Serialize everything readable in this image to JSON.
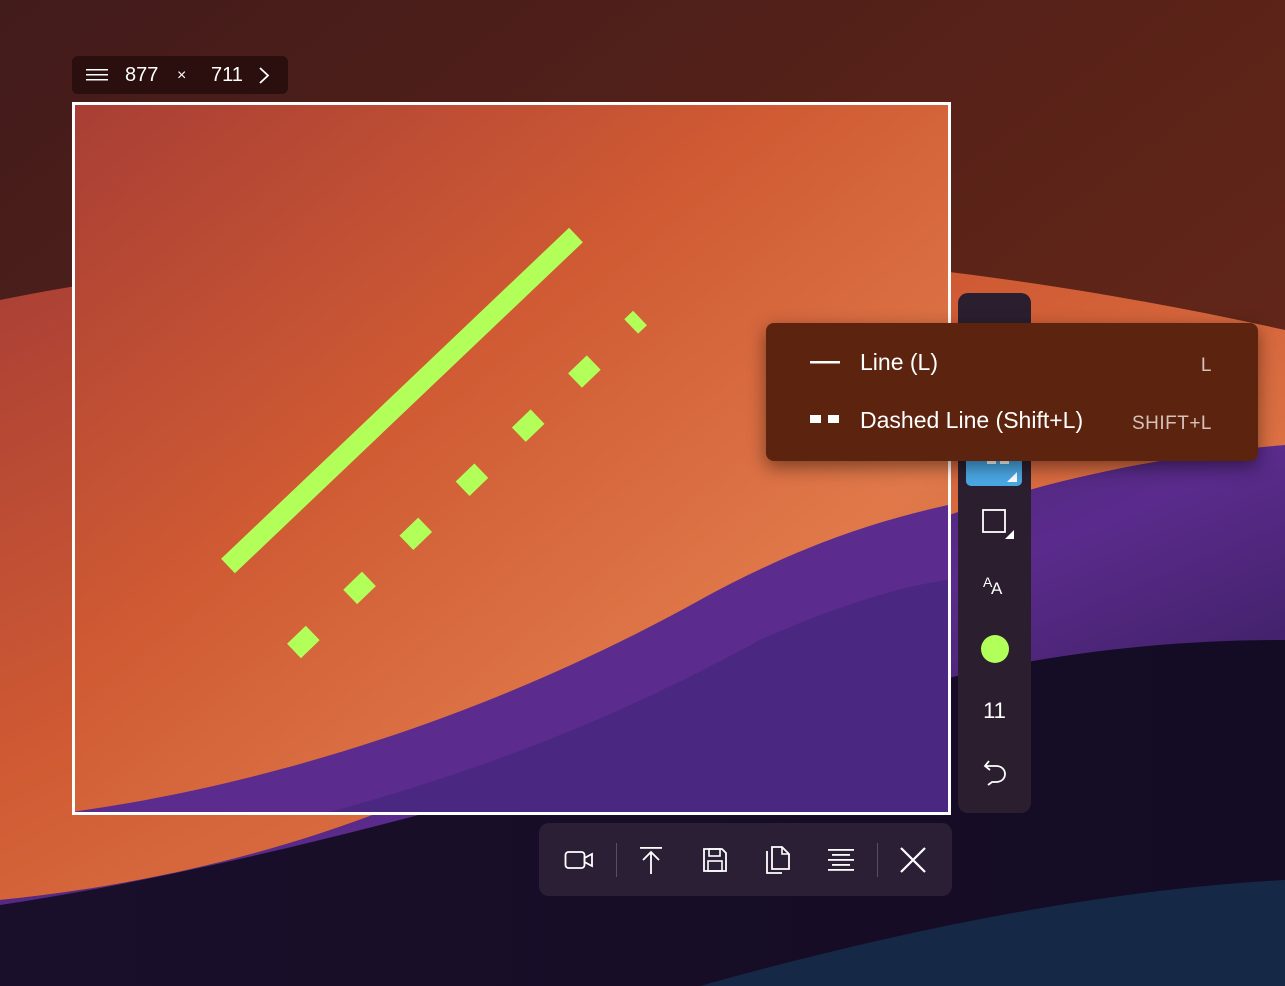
{
  "selection": {
    "width": "877",
    "times": "×",
    "height": "711"
  },
  "colors": {
    "annotation": "#b2ff59",
    "selected_tool": "#4aa8e4",
    "menu_background": "#5c230f",
    "toolbar_background": "#2b1f36"
  },
  "line_menu": {
    "items": [
      {
        "label": "Line (L)",
        "shortcut": "L",
        "icon": "solid-line-icon"
      },
      {
        "label": "Dashed Line (Shift+L)",
        "shortcut": "SHIFT+L",
        "icon": "dashed-line-icon"
      }
    ]
  },
  "side_toolbar": {
    "tools": [
      "line-tool",
      "rectangle-tool",
      "text-tool",
      "color-picker",
      "size",
      "undo"
    ],
    "size_value": "11",
    "color": "#b2ff59"
  },
  "bottom_toolbar": {
    "buttons": [
      "record-video",
      "upload",
      "save",
      "copy",
      "ocr-text",
      "close"
    ]
  }
}
